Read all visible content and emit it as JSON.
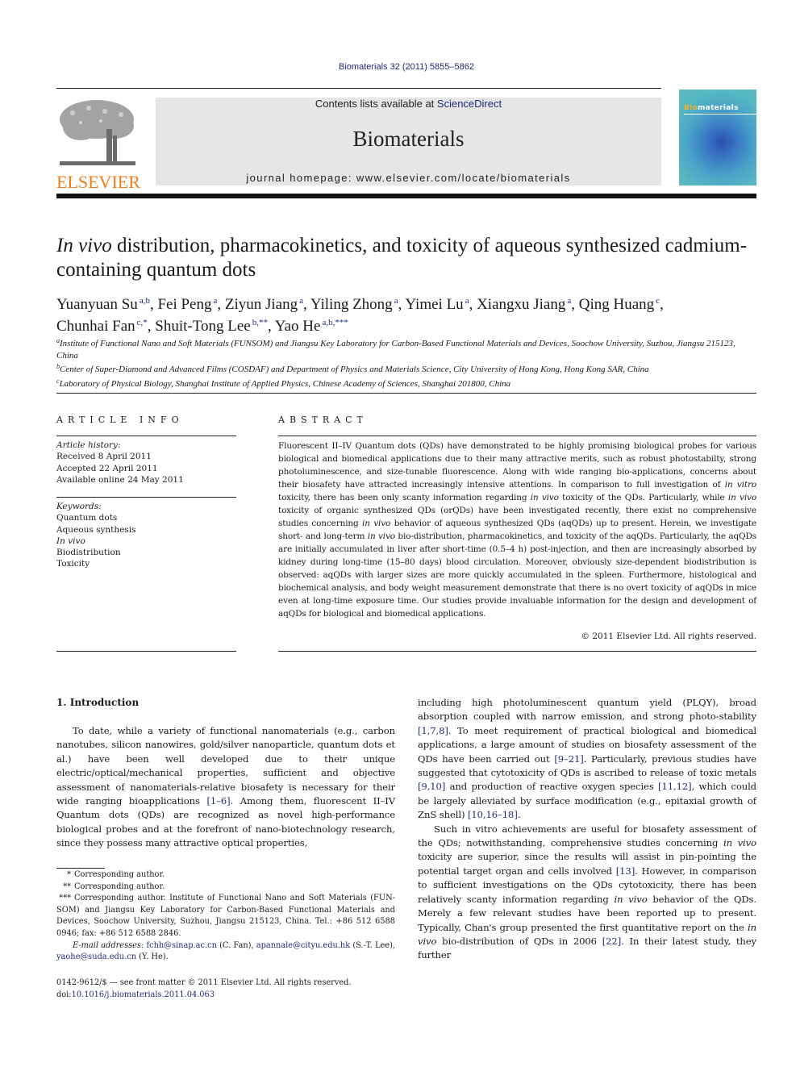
{
  "header": {
    "journal_ref": "Biomaterials 32 (2011) 5855–5862",
    "contents_prefix": "Contents lists available at ",
    "contents_link": "ScienceDirect",
    "journal_name": "Biomaterials",
    "homepage_prefix": "journal homepage: ",
    "homepage_url": "www.elsevier.com/locate/biomaterials",
    "publisher_logo_text": "ELSEVIER",
    "cover_title_a": "Bio",
    "cover_title_b": "materials",
    "colors": {
      "elsevier_orange": "#f07d1a",
      "link_blue": "#1f2a7a",
      "banner_gray": "#e6e6e6"
    }
  },
  "article": {
    "title_italic": "In vivo",
    "title_rest": " distribution, pharmacokinetics, and toxicity of aqueous synthesized cadmium-containing quantum dots",
    "authors": [
      {
        "name": "Yuanyuan Su",
        "sup": "a,b"
      },
      {
        "name": "Fei Peng",
        "sup": "a"
      },
      {
        "name": "Ziyun Jiang",
        "sup": "a"
      },
      {
        "name": "Yiling Zhong",
        "sup": "a"
      },
      {
        "name": "Yimei Lu",
        "sup": "a"
      },
      {
        "name": "Xiangxu Jiang",
        "sup": "a"
      },
      {
        "name": "Qing Huang",
        "sup": "c"
      },
      {
        "name": "Chunhai Fan",
        "sup": "c,*"
      },
      {
        "name": "Shuit-Tong Lee",
        "sup": "b,**"
      },
      {
        "name": "Yao He",
        "sup": "a,b,***"
      }
    ],
    "affiliations": [
      {
        "sup": "a",
        "text": "Institute of Functional Nano and Soft Materials (FUNSOM) and Jiangsu Key Laboratory for Carbon-Based Functional Materials and Devices, Soochow University, Suzhou, Jiangsu 215123, China"
      },
      {
        "sup": "b",
        "text": "Center of Super-Diamond and Advanced Films (COSDAF) and Department of Physics and Materials Science, City University of Hong Kong, Hong Kong SAR, China"
      },
      {
        "sup": "c",
        "text": "Laboratory of Physical Biology, Shanghai Institute of Applied Physics, Chinese Academy of Sciences, Shanghai 201800, China"
      }
    ]
  },
  "article_info": {
    "heading": "ARTICLE INFO",
    "history_label": "Article history:",
    "history": [
      "Received 8 April 2011",
      "Accepted 22 April 2011",
      "Available online 24 May 2011"
    ],
    "keywords_label": "Keywords:",
    "keywords": [
      "Quantum dots",
      "Aqueous synthesis",
      "In vivo",
      "Biodistribution",
      "Toxicity"
    ]
  },
  "abstract": {
    "heading": "ABSTRACT",
    "p1": "Fluorescent II–IV Quantum dots (QDs) have demonstrated to be highly promising biological probes for various biological and biomedical applications due to their many attractive merits, such as robust photostabilty, strong photoluminescence, and size-tunable fluorescence. Along with wide ranging bio-applications, concerns about their biosafety have attracted increasingly intensive attentions. In comparison to full investigation of ",
    "i1": "in vitro",
    "p2": " toxicity, there has been only scanty information regarding ",
    "i2": "in vivo",
    "p3": " toxicity of the QDs. Particularly, while ",
    "i3": "in vivo",
    "p4": " toxicity of organic synthesized QDs (orQDs) have been investigated recently, there exist no comprehensive studies concerning ",
    "i4": "in vivo",
    "p5": " behavior of aqueous synthesized QDs (aqQDs) up to present. Herein, we investigate short- and long-term ",
    "i5": "in vivo",
    "p6": " bio-distribution, pharmacokinetics, and toxicity of the aqQDs. Particularly, the aqQDs are initially accumulated in liver after short-time (0.5–4 h) post-injection, and then are increasingly absorbed by kidney during long-time (15–80 days) blood circulation. Moreover, obviously size-dependent biodistribution is observed: aqQDs with larger sizes are more quickly accumulated in the spleen. Furthermore, histological and biochemical analysis, and body weight measurement demonstrate that there is no overt toxicity of aqQDs in mice even at long-time exposure time. Our studies provide invaluable information for the design and development of aqQDs for biological and biomedical applications.",
    "copyright": "© 2011 Elsevier Ltd. All rights reserved."
  },
  "body": {
    "section_title": "1.  Introduction",
    "left_para": {
      "t1": "To date, while a variety of functional nanomaterials (e.g., carbon nanotubes, silicon nanowires, gold/silver nanoparticle, quantum dots et al.) have been well developed due to their unique electric/optical/mechanical properties, sufficient and objective assessment of nanomaterials-relative biosafety is necessary for their wide ranging bioapplications ",
      "r1": "[1–6]",
      "t2": ". Among them, fluorescent II–IV Quantum dots (QDs) are recognized as novel high-performance biological probes and at the forefront of nano-biotechnology research, since they possess many attractive optical properties,"
    },
    "right_para1": {
      "t1": "including high photoluminescent quantum yield (PLQY), broad absorption coupled with narrow emission, and strong photo-stability ",
      "r1": "[1,7,8]",
      "t2": ". To meet requirement of practical biological and biomedical applications, a large amount of studies on biosafety assessment of the QDs have been carried out ",
      "r2": "[9–21]",
      "t3": ". Particularly, previous studies have suggested that cytotoxicity of QDs is ascribed to release of toxic metals ",
      "r3": "[9,10]",
      "t4": " and production of reactive oxygen species ",
      "r4": "[11,12]",
      "t5": ", which could be largely alleviated by surface modification (e.g., epitaxial growth of ZnS shell) ",
      "r5": "[10,16–18]",
      "t6": "."
    },
    "right_para2": {
      "t1": "Such in vitro achievements are useful for biosafety assessment of the QDs; notwithstanding, comprehensive studies concerning ",
      "i1": "in vivo",
      "t2": " toxicity are superior, since the results will assist in pin-pointing the potential target organ and cells involved ",
      "r1": "[13]",
      "t3": ". However, in comparison to sufficient investigations on the QDs cytotoxicity, there has been relatively scanty information regarding ",
      "i2": "in vivo",
      "t4": " behavior of the QDs. Merely a few relevant studies have been reported up to present. Typically, Chan's group presented the first quantitative report on the ",
      "i3": "in vivo",
      "t5": " bio-distribution of QDs in 2006 ",
      "r2": "[22]",
      "t6": ". In their latest study, they further"
    }
  },
  "footnotes": {
    "fn1_mark": "*",
    "fn1": "Corresponding author.",
    "fn2_mark": "**",
    "fn2": "Corresponding author.",
    "fn3_mark": "***",
    "fn3": "Corresponding author. Institute of Functional Nano and Soft Materials (FUN-SOM) and Jiangsu Key Laboratory for Carbon-Based Functional Materials and Devices, Soochow University, Suzhou, Jiangsu 215123, China. Tel.: +86 512 6588 0946; fax: +86 512 6588 2846.",
    "email_label": "E-mail addresses:",
    "email1": "fchh@sinap.ac.cn",
    "email1_who": " (C. Fan), ",
    "email2": "apannale@cityu.edu.hk",
    "email2_who": " (S.-T. Lee), ",
    "email3": "yaohe@suda.edu.cn",
    "email3_who": " (Y. He).",
    "frontmatter": "0142-9612/$ — see front matter © 2011 Elsevier Ltd. All rights reserved.",
    "doi_prefix": "doi:",
    "doi": "10.1016/j.biomaterials.2011.04.063"
  }
}
